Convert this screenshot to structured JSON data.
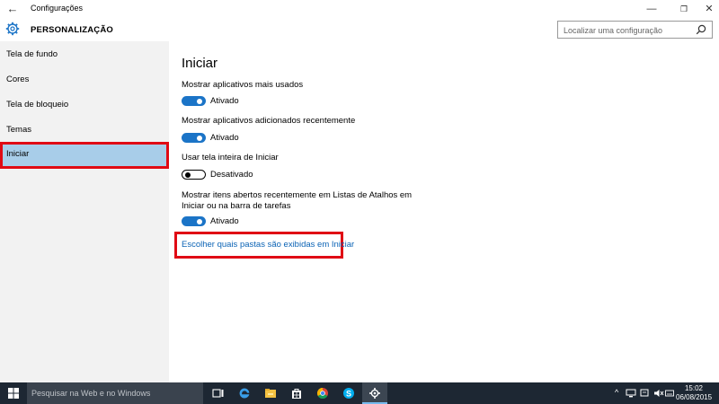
{
  "window": {
    "title": "Configurações",
    "back_glyph": "←",
    "min_glyph": "—",
    "max_glyph": "❐",
    "close_glyph": "✕"
  },
  "header": {
    "section": "PERSONALIZAÇÃO",
    "search_placeholder": "Localizar uma configuração"
  },
  "sidebar": {
    "items": [
      {
        "label": "Tela de fundo"
      },
      {
        "label": "Cores"
      },
      {
        "label": "Tela de bloqueio"
      },
      {
        "label": "Temas"
      },
      {
        "label": "Iniciar",
        "selected": true
      }
    ]
  },
  "main": {
    "title": "Iniciar",
    "settings": [
      {
        "label": "Mostrar aplicativos mais usados",
        "state": "Ativado",
        "on": true
      },
      {
        "label": "Mostrar aplicativos adicionados recentemente",
        "state": "Ativado",
        "on": true
      },
      {
        "label": "Usar tela inteira de Iniciar",
        "state": "Desativado",
        "on": false
      },
      {
        "label_line1": "Mostrar itens abertos recentemente em Listas de Atalhos em",
        "label_line2": "Iniciar ou na barra de tarefas",
        "state": "Ativado",
        "on": true
      }
    ],
    "link": "Escolher quais pastas são exibidas em Iniciar"
  },
  "taskbar": {
    "search_placeholder": "Pesquisar na Web e no Windows",
    "apps": [
      "task-view-icon",
      "edge-icon",
      "file-explorer-icon",
      "store-icon",
      "chrome-icon",
      "skype-icon",
      "settings-icon"
    ],
    "clock_time": "15:02",
    "clock_date": "06/08/2015",
    "tray_chevron": "^"
  },
  "colors": {
    "accent": "#1b74c7",
    "selected_bg": "#a8cde9",
    "highlight_red": "#e00a14",
    "link": "#0b63b5",
    "taskbar": "#1d2733"
  }
}
